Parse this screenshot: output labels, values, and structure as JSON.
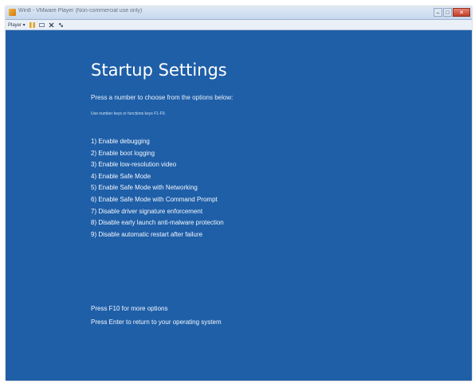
{
  "window": {
    "title": "Win8 - VMware Player (Non-commercial use only)",
    "minimize_glyph": "–",
    "maximize_glyph": "□",
    "close_glyph": "✕"
  },
  "toolbar": {
    "player_label": "Player ▾",
    "icons": [
      "pause-icon",
      "send-ctrl-alt-del-icon",
      "fullscreen-icon",
      "unity-icon"
    ]
  },
  "screen": {
    "background": "#1f5fa8",
    "heading": "Startup Settings",
    "subtitle": "Press a number to choose from the options below:",
    "hint": "Use number keys or functions keys F1-F9.",
    "options": [
      "1) Enable debugging",
      "2) Enable boot logging",
      "3) Enable low-resolution video",
      "4) Enable Safe Mode",
      "5) Enable Safe Mode with Networking",
      "6) Enable Safe Mode with Command Prompt",
      "7) Disable driver signature enforcement",
      "8) Disable early launch anti-malware protection",
      "9) Disable automatic restart after failure"
    ],
    "footer_more": "Press F10 for more options",
    "footer_return": "Press Enter to return to your operating system"
  }
}
